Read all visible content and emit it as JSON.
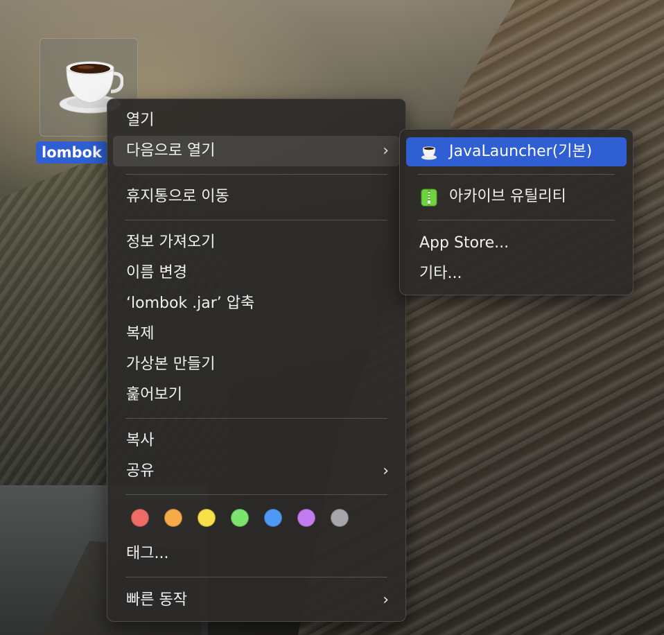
{
  "desktop_file": {
    "name": "lombok",
    "icon": "java-coffee-cup-icon"
  },
  "context_menu": {
    "items": [
      {
        "label": "열기"
      },
      {
        "label": "다음으로 열기",
        "has_submenu": true
      },
      {
        "label": "휴지통으로 이동"
      },
      {
        "label": "정보 가져오기"
      },
      {
        "label": "이름 변경"
      },
      {
        "label": "‘lombok .jar’ 압축"
      },
      {
        "label": "복제"
      },
      {
        "label": "가상본 만들기"
      },
      {
        "label": "훑어보기"
      },
      {
        "label": "복사"
      },
      {
        "label": "공유",
        "has_submenu": true
      },
      {
        "label": "태그..."
      },
      {
        "label": "빠른 동작",
        "has_submenu": true
      }
    ],
    "tag_colors": [
      {
        "name": "red",
        "color": "#ee6b68"
      },
      {
        "name": "orange",
        "color": "#f5ab4a"
      },
      {
        "name": "yellow",
        "color": "#f9e04b"
      },
      {
        "name": "green",
        "color": "#7ce36f"
      },
      {
        "name": "blue",
        "color": "#4f98f5"
      },
      {
        "name": "purple",
        "color": "#c27cf0"
      },
      {
        "name": "gray",
        "color": "#a7a7ab"
      }
    ],
    "chevron": "›"
  },
  "open_with_submenu": {
    "items": [
      {
        "label": "JavaLauncher(기본)",
        "icon": "java-coffee-cup-icon",
        "selected": true
      },
      {
        "label": "아카이브 유틸리티",
        "icon": "archive-utility-icon"
      },
      {
        "label": "App Store..."
      },
      {
        "label": "기타..."
      }
    ]
  },
  "colors": {
    "selection_blue": "#2f5fd3",
    "menu_background": "#2c2a28"
  }
}
